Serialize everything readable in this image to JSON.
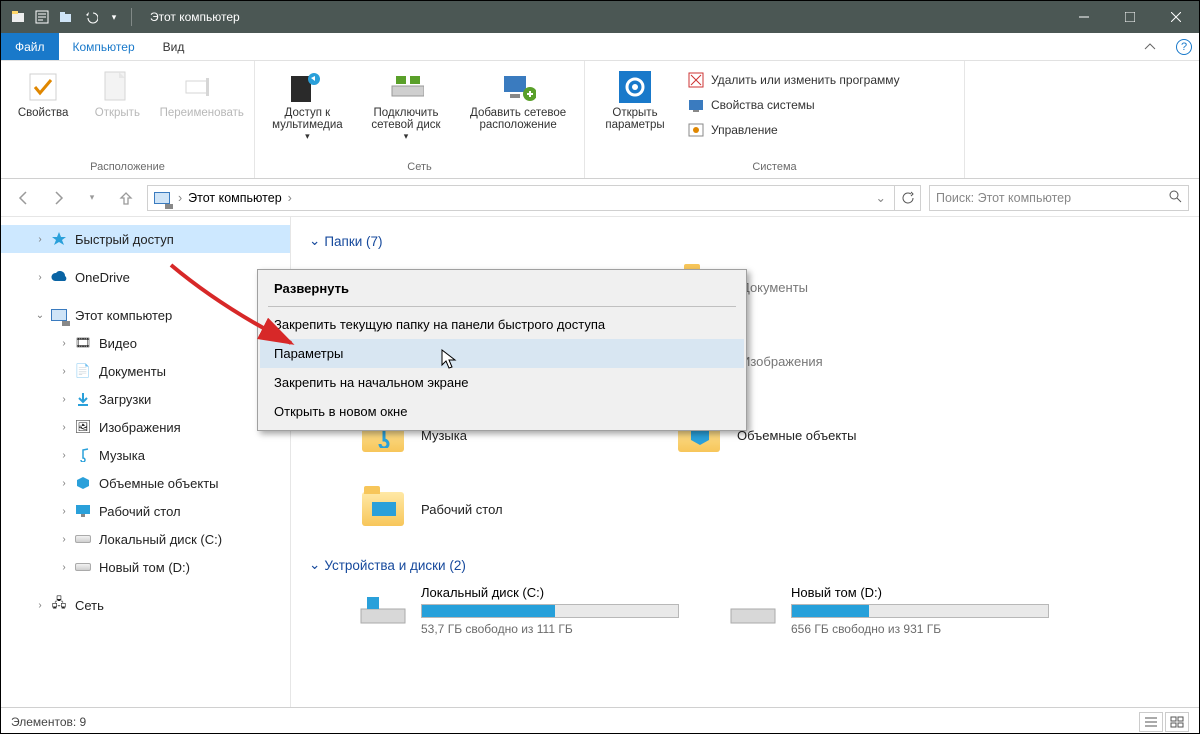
{
  "title": "Этот компьютер",
  "tabs": {
    "file": "Файл",
    "computer": "Компьютер",
    "view": "Вид"
  },
  "ribbon": {
    "group_location": "Расположение",
    "group_network": "Сеть",
    "group_system": "Система",
    "properties": "Свойства",
    "open": "Открыть",
    "rename": "Переименовать",
    "media": "Доступ к\nмультимедиа",
    "map_drive": "Подключить\nсетевой диск",
    "add_net": "Добавить сетевое\nрасположение",
    "open_settings": "Открыть\nпараметры",
    "uninstall": "Удалить или изменить программу",
    "sys_props": "Свойства системы",
    "manage": "Управление"
  },
  "breadcrumb": {
    "root": "Этот компьютер"
  },
  "search_placeholder": "Поиск: Этот компьютер",
  "sidebar": {
    "quick": "Быстрый доступ",
    "onedrive": "OneDrive",
    "thispc": "Этот компьютер",
    "video": "Видео",
    "documents": "Документы",
    "downloads": "Загрузки",
    "pictures": "Изображения",
    "music": "Музыка",
    "objects3d": "Объемные объекты",
    "desktop": "Рабочий стол",
    "diskc": "Локальный диск (C:)",
    "diskd": "Новый том (D:)",
    "network": "Сеть"
  },
  "sections": {
    "folders": "Папки (7)",
    "drives": "Устройства и диски (2)"
  },
  "folders": {
    "documents": "Документы",
    "pictures": "Изображения",
    "music": "Музыка",
    "objects3d": "Объемные объекты",
    "desktop": "Рабочий стол"
  },
  "drives": {
    "c": {
      "name": "Локальный диск (C:)",
      "free": "53,7 ГБ свободно из 111 ГБ",
      "pct": 52
    },
    "d": {
      "name": "Новый том (D:)",
      "free": "656 ГБ свободно из 931 ГБ",
      "pct": 30
    }
  },
  "ctx": {
    "expand": "Развернуть",
    "pin_quick": "Закрепить текущую папку на панели быстрого доступа",
    "options": "Параметры",
    "pin_start": "Закрепить на начальном экране",
    "open_new": "Открыть в новом окне"
  },
  "status": "Элементов: 9"
}
